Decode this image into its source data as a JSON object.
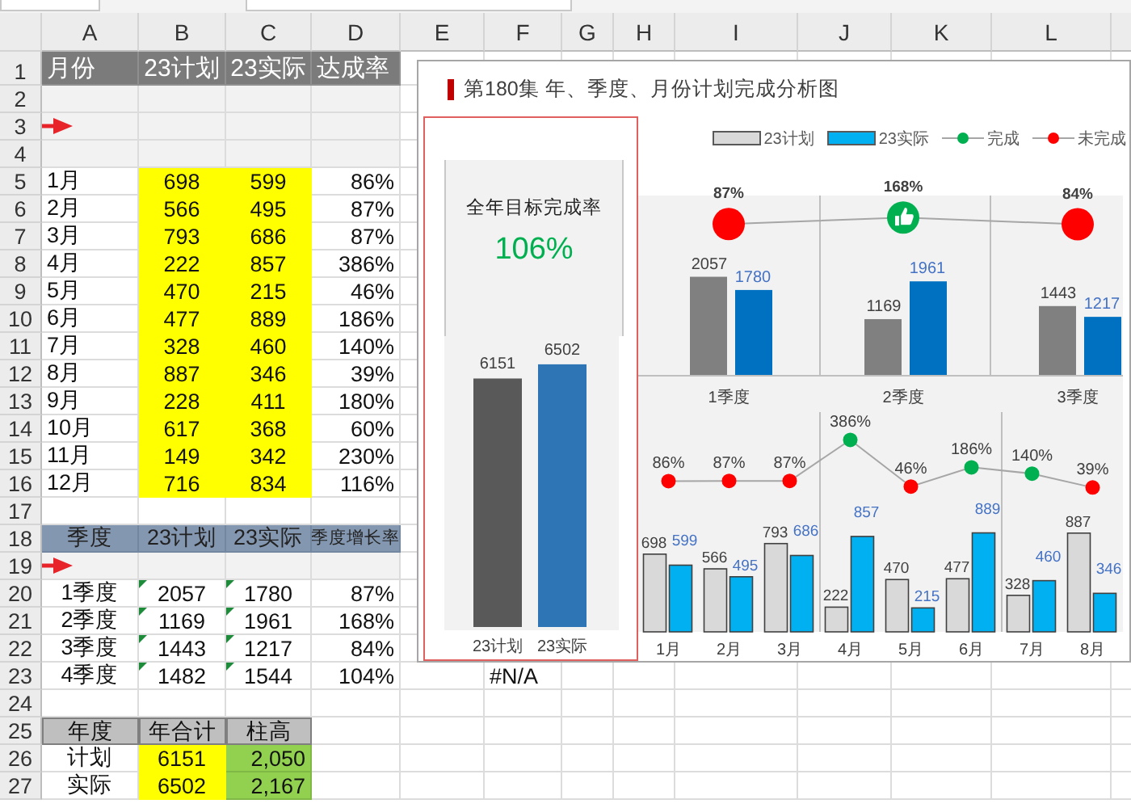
{
  "sheet": {
    "columns": [
      "A",
      "B",
      "C",
      "D",
      "E",
      "F",
      "G",
      "H",
      "I",
      "J",
      "K",
      "L"
    ],
    "rows": [
      {
        "num": "1",
        "kind": "head_dark",
        "cells": [
          "月份",
          "23计划",
          "23实际",
          "达成率"
        ]
      },
      {
        "num": "2",
        "kind": "band"
      },
      {
        "num": "3",
        "kind": "band_arrow"
      },
      {
        "num": "4",
        "kind": "band"
      },
      {
        "num": "5",
        "kind": "month",
        "cells": [
          "1月",
          "698",
          "599",
          "86%"
        ]
      },
      {
        "num": "6",
        "kind": "month",
        "cells": [
          "2月",
          "566",
          "495",
          "87%"
        ]
      },
      {
        "num": "7",
        "kind": "month",
        "cells": [
          "3月",
          "793",
          "686",
          "87%"
        ]
      },
      {
        "num": "8",
        "kind": "month",
        "cells": [
          "4月",
          "222",
          "857",
          "386%"
        ]
      },
      {
        "num": "9",
        "kind": "month",
        "cells": [
          "5月",
          "470",
          "215",
          "46%"
        ]
      },
      {
        "num": "10",
        "kind": "month",
        "cells": [
          "6月",
          "477",
          "889",
          "186%"
        ]
      },
      {
        "num": "11",
        "kind": "month",
        "cells": [
          "7月",
          "328",
          "460",
          "140%"
        ]
      },
      {
        "num": "12",
        "kind": "month",
        "cells": [
          "8月",
          "887",
          "346",
          "39%"
        ]
      },
      {
        "num": "13",
        "kind": "month",
        "cells": [
          "9月",
          "228",
          "411",
          "180%"
        ]
      },
      {
        "num": "14",
        "kind": "month",
        "cells": [
          "10月",
          "617",
          "368",
          "60%"
        ]
      },
      {
        "num": "15",
        "kind": "month",
        "cells": [
          "11月",
          "149",
          "342",
          "230%"
        ]
      },
      {
        "num": "16",
        "kind": "month",
        "cells": [
          "12月",
          "716",
          "834",
          "116%"
        ]
      },
      {
        "num": "17",
        "kind": "blank"
      },
      {
        "num": "18",
        "kind": "head_blue",
        "cells": [
          "季度",
          "23计划",
          "23实际",
          "季度增长率"
        ]
      },
      {
        "num": "19",
        "kind": "band_arrow"
      },
      {
        "num": "20",
        "kind": "quarter",
        "cells": [
          "1季度",
          "2057",
          "1780",
          "87%"
        ]
      },
      {
        "num": "21",
        "kind": "quarter",
        "cells": [
          "2季度",
          "1169",
          "1961",
          "168%"
        ]
      },
      {
        "num": "22",
        "kind": "quarter",
        "cells": [
          "3季度",
          "1443",
          "1217",
          "84%"
        ]
      },
      {
        "num": "23",
        "kind": "quarter",
        "cells": [
          "4季度",
          "1482",
          "1544",
          "104%"
        ],
        "col_f": "#N/A"
      },
      {
        "num": "24",
        "kind": "blank"
      },
      {
        "num": "25",
        "kind": "head_grey",
        "cells": [
          "年度",
          "年合计",
          "柱高"
        ]
      },
      {
        "num": "26",
        "kind": "year",
        "cells": [
          "计划",
          "6151",
          "2,050"
        ]
      },
      {
        "num": "27",
        "kind": "year",
        "cells": [
          "实际",
          "6502",
          "2,167"
        ]
      }
    ]
  },
  "chart": {
    "title": "第180集 年、季度、月份计划完成分析图",
    "status_legend": [
      {
        "label": "完成",
        "color": "#00b050"
      },
      {
        "label": "未完成",
        "color": "#ff0000"
      }
    ],
    "annual": {
      "heading": "全年目标完成率",
      "rate": "106%",
      "chart_data": {
        "type": "bar",
        "categories": [
          "23计划",
          "23实际"
        ],
        "values": [
          6151,
          6502
        ],
        "data_labels": true
      }
    },
    "quarters": {
      "chart_data": {
        "type": "bar",
        "categories": [
          "1季度",
          "2季度",
          "3季度"
        ],
        "series": [
          {
            "color": "#808080",
            "values": [
              2057,
              1169,
              1443
            ]
          },
          {
            "color": "#0070c0",
            "values": [
              1780,
              1961,
              1217
            ]
          }
        ],
        "data_labels": true
      }
    },
    "quarter_rates": {
      "chart_data": {
        "type": "line",
        "marker": true,
        "values": [
          87,
          168,
          84
        ],
        "value_labels": [
          "87%",
          "168%",
          "84%"
        ]
      }
    },
    "months": {
      "chart_data": {
        "type": "bar",
        "categories": [
          "1月",
          "2月",
          "3月",
          "4月",
          "5月",
          "6月",
          "7月",
          "8月"
        ],
        "series": [
          {
            "name": "23计划",
            "color": "#d9d9d9",
            "values": [
              698,
              566,
              793,
              222,
              470,
              477,
              328,
              887
            ]
          },
          {
            "name": "23实际",
            "color": "#00b0f0",
            "values": [
              599,
              495,
              686,
              857,
              215,
              889,
              460,
              346
            ]
          }
        ],
        "data_labels": true
      }
    },
    "month_rates": {
      "chart_data": {
        "type": "line",
        "marker": true,
        "values": [
          86,
          87,
          87,
          386,
          46,
          186,
          140,
          39
        ],
        "value_labels": [
          "86%",
          "87%",
          "87%",
          "386%",
          "46%",
          "186%",
          "140%",
          "39%"
        ]
      }
    }
  }
}
